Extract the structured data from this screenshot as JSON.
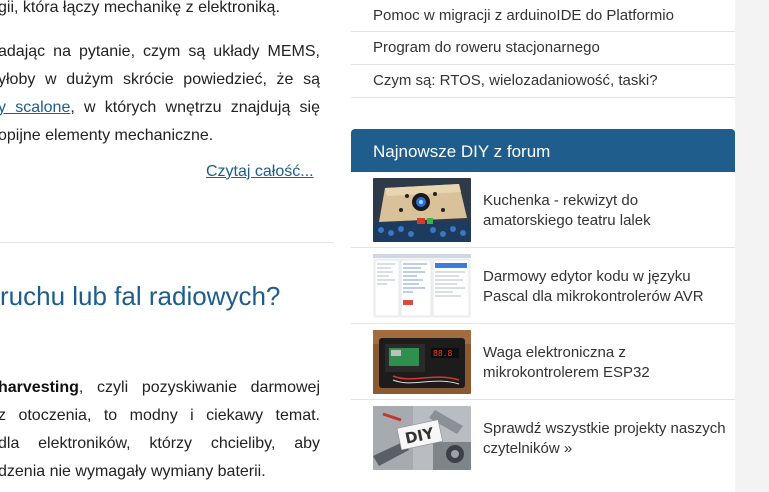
{
  "article": {
    "para1_lines": [
      "gii, która łączy mechanikę z elektroniką."
    ],
    "para2": {
      "line1": "adając na pytanie, czym są układy MEMS,",
      "line2": "yłoby w dużym skrócie powiedzieć, że są",
      "line3_link": "y scalone",
      "line3_rest": ", w których wnętrzu znajdują się",
      "line4": "opijne elementy mechaniczne."
    },
    "read_more": "Czytaj całość...",
    "heading": "ruchu lub fal radiowych?",
    "para3": {
      "line1_bold": "harvesting",
      "line1_rest": ", czyli pozyskiwanie darmowej",
      "line2": "z otoczenia, to modny i ciekawy temat.",
      "line3": "dla elektroników, którzy chcieliby, aby",
      "line4": "dzenia nie wymagały wymiany baterii."
    }
  },
  "sidebar": {
    "links": [
      "Pomoc w migracji z arduinoIDE do Platformio",
      "Program do roweru stacjonarnego",
      "Czym są: RTOS, wielozadaniowość, taski?"
    ],
    "diy_title": "Najnowsze DIY z forum",
    "diy_items": [
      {
        "title": "Kuchenka - rekwizyt do amatorskiego teatru lalek"
      },
      {
        "title": "Darmowy edytor kodu w języku Pascal dla mikrokontrolerów AVR"
      },
      {
        "title": "Waga elektroniczna z mikrokontrolerem ESP32"
      },
      {
        "title": "Sprawdź wszystkie projekty naszych czytelników »"
      }
    ],
    "thumb_badge": "DIY"
  },
  "colors": {
    "accent": "#1f5d8c",
    "link": "#1d5d8c"
  }
}
